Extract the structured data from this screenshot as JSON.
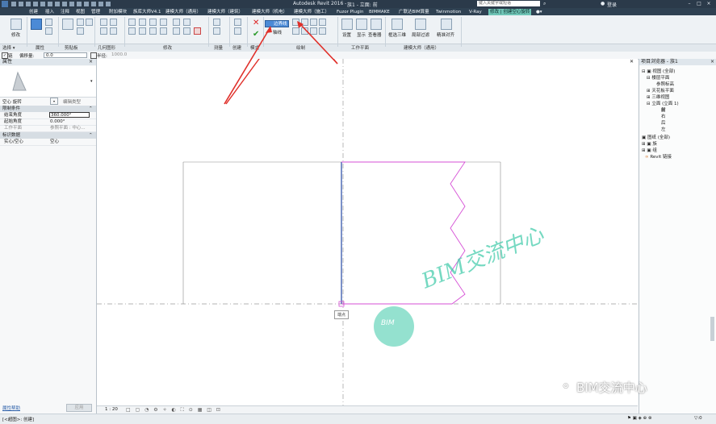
{
  "titlebar": {
    "app_title": "Autodesk Revit 2016 -",
    "document": "族1 - 立面: 前",
    "search_placeholder": "键入关键字或短语",
    "user": "登录"
  },
  "tabs": [
    {
      "label": "创建",
      "active": false
    },
    {
      "label": "插入",
      "active": false
    },
    {
      "label": "注释",
      "active": false
    },
    {
      "label": "视图",
      "active": false
    },
    {
      "label": "管理",
      "active": false
    },
    {
      "label": "附加模块",
      "active": false
    },
    {
      "label": "族库大师V4.1",
      "active": false
    },
    {
      "label": "建模大师（通用）",
      "active": false
    },
    {
      "label": "建模大师（建筑）",
      "active": false
    },
    {
      "label": "建模大师（机电）",
      "active": false
    },
    {
      "label": "建模大师（施工）",
      "active": false
    },
    {
      "label": "Fuzor Plugin",
      "active": false
    },
    {
      "label": "BIMMAKE",
      "active": false
    },
    {
      "label": "广联达BIM算量",
      "active": false
    },
    {
      "label": "Twinmotion",
      "active": false
    },
    {
      "label": "V-Ray",
      "active": false
    },
    {
      "label": "修改 | 创建空心旋转",
      "active": true
    }
  ],
  "ribbon": {
    "modify_label": "修改",
    "boundary_line_label": "边界线",
    "axis_line_label": "轴线",
    "set_label": "设置",
    "show_label": "显示",
    "viewer_label": "查看器",
    "zoom_3d_label": "框选三维",
    "filter_label": "局部过滤",
    "align_label": "精准对齐",
    "panels": [
      "选择 ▾",
      "属性",
      "剪贴板",
      "几何图形",
      "修改",
      "测量",
      "创建",
      "模式",
      "绘制",
      "工作平面",
      "建模大师（通用）"
    ]
  },
  "optionbar": {
    "chain_label": "链",
    "offset_label": "偏移量:",
    "offset_value": "0.0",
    "radius_label": "半径:",
    "radius_value": "1000.0"
  },
  "properties": {
    "title": "属性",
    "type_selector": "空心 旋转",
    "edit_type_label": "编辑类型",
    "constraints_header": "限制条件",
    "rows": [
      {
        "key": "结束角度",
        "value": "360.000°"
      },
      {
        "key": "起始角度",
        "value": "0.000°"
      },
      {
        "key": "工作平面",
        "value": "参照平面 : 中心..."
      }
    ],
    "identity_header": "标识数据",
    "identity_rows": [
      {
        "key": "实心/空心",
        "value": "空心"
      }
    ],
    "help_link": "属性帮助",
    "apply_label": "应用"
  },
  "browser": {
    "title": "项目浏览器 - 族1",
    "nodes": [
      {
        "label": "视图 (全部)",
        "level": 0
      },
      {
        "label": "楼层平面",
        "level": 1
      },
      {
        "label": "参照标高",
        "level": 2
      },
      {
        "label": "天花板平面",
        "level": 1
      },
      {
        "label": "三维视图",
        "level": 1
      },
      {
        "label": "立面 (立面 1)",
        "level": 1
      },
      {
        "label": "前",
        "level": 2
      },
      {
        "label": "右",
        "level": 2
      },
      {
        "label": "后",
        "level": 2
      },
      {
        "label": "左",
        "level": 2
      },
      {
        "label": "图纸 (全部)",
        "level": 0
      },
      {
        "label": "族",
        "level": 0
      },
      {
        "label": "组",
        "level": 0
      },
      {
        "label": "Revit 链接",
        "level": 0
      }
    ]
  },
  "canvas": {
    "endpoint_tooltip": "端点",
    "watermark": "BIM交流中心",
    "watermark_badge": "BIM"
  },
  "viewbar": {
    "scale": "1 : 20"
  },
  "status": {
    "hint": "[<超图>: 创建]",
    "brand": "BIM交流中心",
    "filter_value": ":0"
  },
  "colors": {
    "ribbon_active": "#6ec4b5",
    "sketch_magenta": "#d64fd6",
    "axis_blue": "#3355aa",
    "arrow_red": "#e0302a",
    "watermark_green": "#3cc9a8"
  }
}
